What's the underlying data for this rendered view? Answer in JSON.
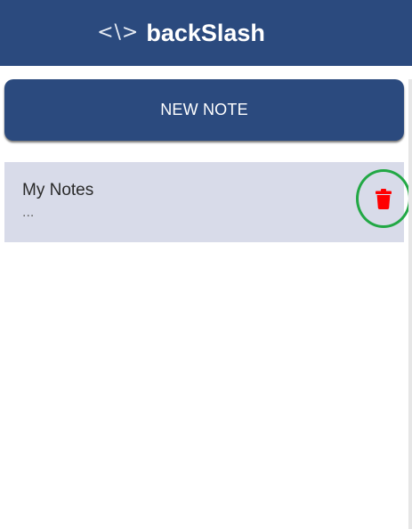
{
  "header": {
    "logo_glyph": "<\\>",
    "title": "backSlash",
    "bg_color": "#2b4a7e"
  },
  "actions": {
    "new_note_label": "NEW NOTE"
  },
  "notes": [
    {
      "title": "My Notes",
      "preview": "...",
      "delete_icon": "trash-icon",
      "delete_color": "#ff0000",
      "highlight_color": "#22a845"
    }
  ],
  "colors": {
    "accent": "#2b4a7e",
    "card_bg": "#d8dbe9"
  }
}
